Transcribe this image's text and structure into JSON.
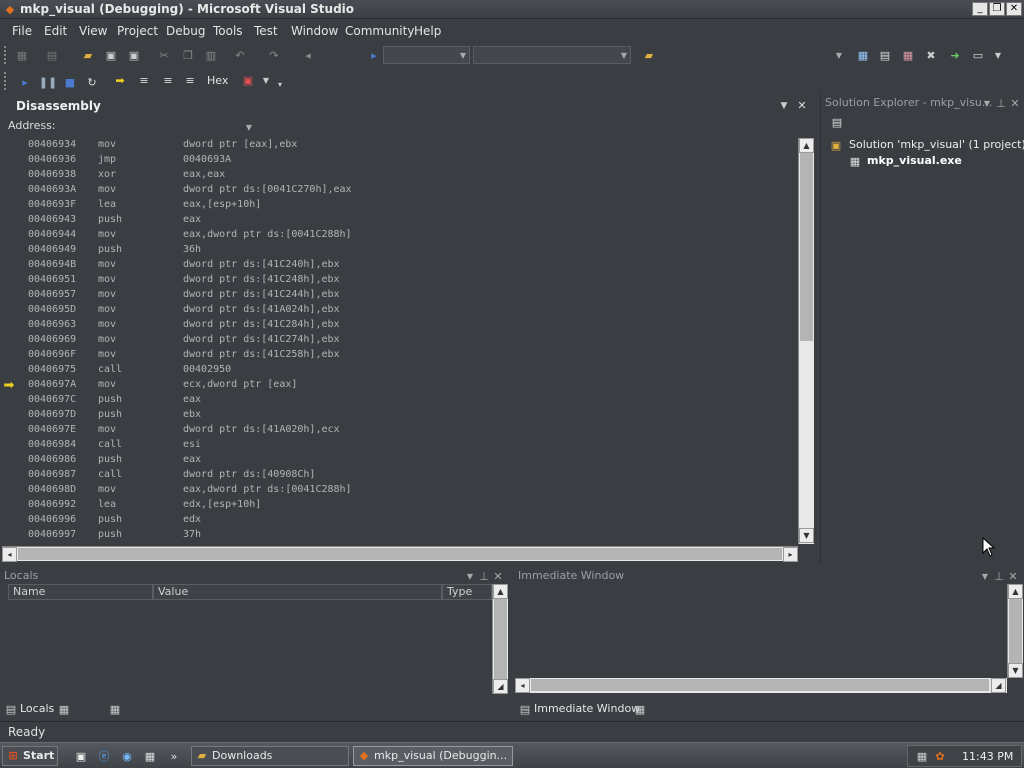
{
  "window": {
    "title": "mkp_visual (Debugging) - Microsoft Visual Studio"
  },
  "menu": [
    "File",
    "Edit",
    "View",
    "Project",
    "Debug",
    "Tools",
    "Test",
    "Window",
    "Community",
    "Help"
  ],
  "toolbar2": {
    "hex_label": "Hex"
  },
  "disassembly": {
    "title": "Disassembly",
    "address_label": "Address:",
    "rows": [
      {
        "addr": "00406934",
        "mnem": "mov",
        "ops": "dword ptr [eax],ebx"
      },
      {
        "addr": "00406936",
        "mnem": "jmp",
        "ops": "0040693A"
      },
      {
        "addr": "00406938",
        "mnem": "xor",
        "ops": "eax,eax"
      },
      {
        "addr": "0040693A",
        "mnem": "mov",
        "ops": "dword ptr ds:[0041C270h],eax"
      },
      {
        "addr": "0040693F",
        "mnem": "lea",
        "ops": "eax,[esp+10h]"
      },
      {
        "addr": "00406943",
        "mnem": "push",
        "ops": "eax"
      },
      {
        "addr": "00406944",
        "mnem": "mov",
        "ops": "eax,dword ptr ds:[0041C288h]"
      },
      {
        "addr": "00406949",
        "mnem": "push",
        "ops": "36h"
      },
      {
        "addr": "0040694B",
        "mnem": "mov",
        "ops": "dword ptr ds:[41C240h],ebx"
      },
      {
        "addr": "00406951",
        "mnem": "mov",
        "ops": "dword ptr ds:[41C248h],ebx"
      },
      {
        "addr": "00406957",
        "mnem": "mov",
        "ops": "dword ptr ds:[41C244h],ebx"
      },
      {
        "addr": "0040695D",
        "mnem": "mov",
        "ops": "dword ptr ds:[41A024h],ebx"
      },
      {
        "addr": "00406963",
        "mnem": "mov",
        "ops": "dword ptr ds:[41C284h],ebx"
      },
      {
        "addr": "00406969",
        "mnem": "mov",
        "ops": "dword ptr ds:[41C274h],ebx"
      },
      {
        "addr": "0040696F",
        "mnem": "mov",
        "ops": "dword ptr ds:[41C258h],ebx"
      },
      {
        "addr": "00406975",
        "mnem": "call",
        "ops": "00402950"
      },
      {
        "addr": "0040697A",
        "mnem": "mov",
        "ops": "ecx,dword ptr [eax]"
      },
      {
        "addr": "0040697C",
        "mnem": "push",
        "ops": "eax"
      },
      {
        "addr": "0040697D",
        "mnem": "push",
        "ops": "ebx"
      },
      {
        "addr": "0040697E",
        "mnem": "mov",
        "ops": "dword ptr ds:[41A020h],ecx"
      },
      {
        "addr": "00406984",
        "mnem": "call",
        "ops": "esi"
      },
      {
        "addr": "00406986",
        "mnem": "push",
        "ops": "eax"
      },
      {
        "addr": "00406987",
        "mnem": "call",
        "ops": "dword ptr ds:[40908Ch]"
      },
      {
        "addr": "0040698D",
        "mnem": "mov",
        "ops": "eax,dword ptr ds:[0041C288h]"
      },
      {
        "addr": "00406992",
        "mnem": "lea",
        "ops": "edx,[esp+10h]"
      },
      {
        "addr": "00406996",
        "mnem": "push",
        "ops": "edx"
      },
      {
        "addr": "00406997",
        "mnem": "push",
        "ops": "37h"
      }
    ]
  },
  "solution_explorer": {
    "title": "Solution Explorer - mkp_visu...",
    "solution": "Solution 'mkp_visual' (1 project)",
    "project": "mkp_visual.exe"
  },
  "locals": {
    "title": "Locals",
    "columns": [
      "Name",
      "Value",
      "Type"
    ],
    "tab_label": "Locals"
  },
  "immediate": {
    "title": "Immediate Window",
    "tab_label": "Immediate Window"
  },
  "status": {
    "text": "Ready"
  },
  "taskbar": {
    "start": "Start",
    "task1": "Downloads",
    "task2": "mkp_visual (Debuggin...",
    "clock": "11:43 PM"
  },
  "colors": {
    "accent_arrow": "#f0d020",
    "code_text": "#b4b4b4"
  }
}
